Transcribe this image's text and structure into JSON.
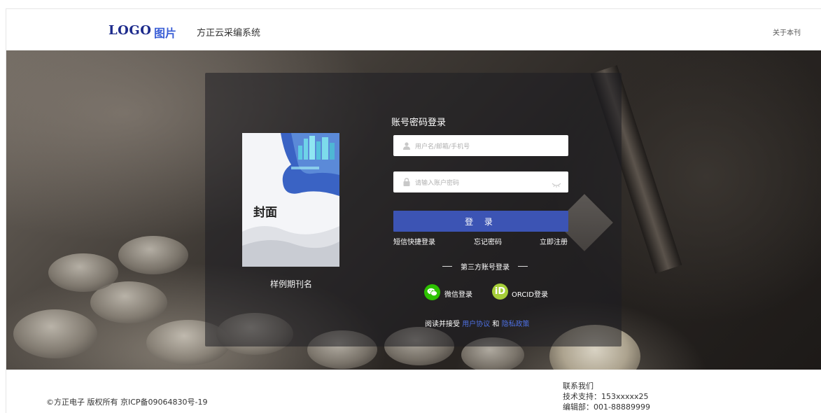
{
  "header": {
    "logo_text": "LOGO",
    "logo_pic": "图片",
    "system_title": "方正云采编系统",
    "about": "关于本刊"
  },
  "cover": {
    "title": "封面",
    "sample_name": "样例期刊名"
  },
  "login": {
    "title": "账号密码登录",
    "username_placeholder": "用户名/邮箱/手机号",
    "password_placeholder": "请输入账户密码",
    "submit": "登 录",
    "sms_login": "短信快捷登录",
    "forgot": "忘记密码",
    "register": "立即注册",
    "third_party_title": "第三方账号登录",
    "wechat": "微信登录",
    "orcid": "ORCID登录",
    "orcid_mark": "iD",
    "agree_prefix": "阅读并接受",
    "user_agreement": "用户协议",
    "and": "和",
    "privacy": "隐私政策"
  },
  "footer": {
    "copyright": "©方正电子 版权所有 京ICP备09064830号-19",
    "contact_title": "联系我们",
    "tech_support": "技术支持：153xxxxx25",
    "editorial": "编辑部：001-88889999"
  },
  "colors": {
    "primary": "#3c54b4",
    "link": "#4d6fe0",
    "wechat": "#2dc100",
    "orcid": "#a6ce39"
  },
  "icons": [
    "user-icon",
    "lock-icon",
    "eye-hidden-icon",
    "wechat-icon",
    "orcid-icon"
  ]
}
